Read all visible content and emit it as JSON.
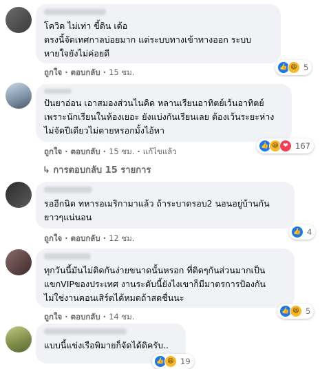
{
  "actions": {
    "like": "ถูกใจ",
    "reply": "ตอบกลับ",
    "edited": "แก้ไขแล้ว"
  },
  "comments": [
    {
      "text": "โควิด ไม่เท่า ขี้ดิน เด้อ\nตรงนี้จัดเทศกาลบ่อยมาก แต่ระบบทางเข้าทางออก ระบบ\nหายใจยังไม่ค่อยดี",
      "time": "15 ชม.",
      "reactions": [
        "like",
        "haha"
      ],
      "count": "5"
    },
    {
      "text": "ปันยาอ่อน เอาสมองส่วนไนคิด หลานเรียนอาทิตย์เว้นอาทิตย์\nเพราะนักเรียนในห้องเยอะ ยังแบ่งกันเรียนเลย ต้องเว้นระยะห่าง\nไม่จัดปีเดียวไม่ตายหรอกมั้งไอ้หา",
      "time": "15 ชม.",
      "reactions": [
        "like",
        "haha",
        "love"
      ],
      "count": "167"
    },
    {
      "text": "รออีกนิด ทหารอเมริกามาแล้ว ถ้าระบาดรอบ2 นอนอยู่บ้านกัน\nยาวๆแน่นอน",
      "time": "12 ชม.",
      "reactions": [
        "like"
      ],
      "count": "4"
    },
    {
      "text": "ทุกวันนี้มันไม่ติดกันง่ายขนาดนั้นหรอก ที่ติดๆกันส่วนมากเป็น\nแขกVIPของประเทศ งานระดับนี้ยังไงเขาก็มีมาตรการป้องกัน\nไม่ใช่งานคอนเสิร์ตได้หมดถ้าสดชื่นนะ",
      "time": "14 ชม.",
      "reactions": [
        "like",
        "haha"
      ],
      "count": "5"
    },
    {
      "text": "แบบนี้แข่งเรือพิมายก็จัดได้ดิครับ..",
      "reactions": [
        "like",
        "haha"
      ],
      "count": "19"
    }
  ],
  "replies_link": "↳ การตอบกลับ 15 รายการ",
  "reaction_icons": {
    "like": "👍",
    "haha": "😆",
    "love": "❤"
  },
  "colors": {
    "bubble": "#f0f2f5",
    "secondary_text": "#65676b",
    "like_blue": "#1877f2"
  }
}
